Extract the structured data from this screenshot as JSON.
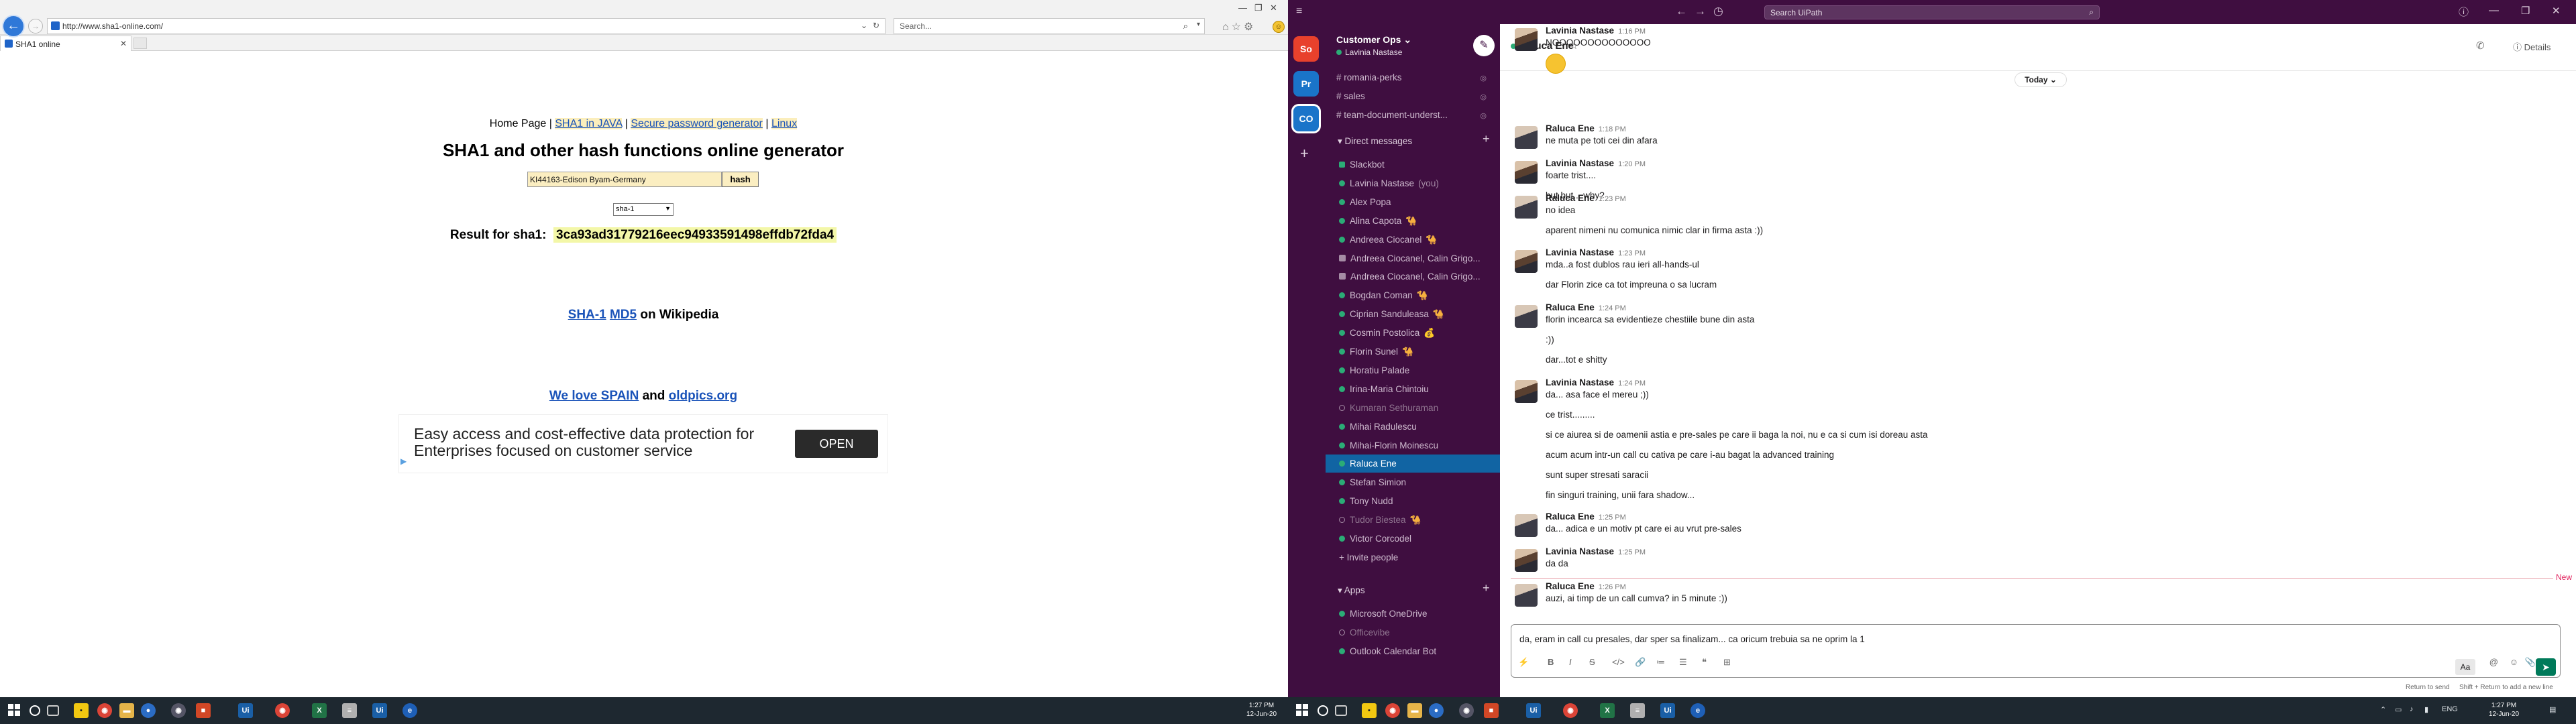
{
  "browser": {
    "address_url": "http://www.sha1-online.com/",
    "search_placeholder": "Search...",
    "tab_title": "SHA1 online"
  },
  "webpage": {
    "nav": {
      "home": "Home Page",
      "sep": "|",
      "java": "SHA1 in JAVA",
      "pwgen": "Secure password generator",
      "linux": "Linux"
    },
    "title": "SHA1 and other hash functions online generator",
    "input_value": "KI44163-Edison Byam-Germany",
    "hash_button": "hash",
    "algorithm_selected": "sha-1",
    "result_label": "Result for sha1:",
    "result_hash": "3ca93ad31779216eec94933591498effdb72fda4",
    "wiki": {
      "sha1": "SHA-1",
      "md5": "MD5",
      "suffix": "on Wikipedia"
    },
    "spain": {
      "link1": "We love SPAIN",
      "and": "and",
      "link2": "oldpics.org"
    },
    "ad": {
      "text": "Easy access and cost-effective data protection for Enterprises focused on customer service",
      "button": "OPEN"
    }
  },
  "taskbar_left": {
    "time": "1:27 PM",
    "date": "12-Jun-20"
  },
  "taskbar_right": {
    "time": "1:27 PM",
    "date": "12-Jun-20",
    "lang": "ENG"
  },
  "slack": {
    "search_placeholder": "Search UiPath",
    "workspaces": [
      {
        "label": "So",
        "color": "#e8412c"
      },
      {
        "label": "Pr",
        "color": "#1a74c9"
      },
      {
        "label": "CO",
        "color": "#1a74c9"
      }
    ],
    "team_name": "Customer Ops",
    "team_caret": "⌄",
    "current_user": "Lavinia Nastase",
    "channels": [
      "# romania-perks",
      "# sales",
      "# team-document-underst..."
    ],
    "dm_header": "Direct messages",
    "dms": [
      {
        "name": "Slackbot",
        "status": "bot",
        "extra": ""
      },
      {
        "name": "Lavinia Nastase",
        "status": "on",
        "extra": "(you)"
      },
      {
        "name": "Alex Popa",
        "status": "on",
        "extra": ""
      },
      {
        "name": "Alina Capota",
        "status": "on",
        "extra": "🐪"
      },
      {
        "name": "Andreea Ciocanel",
        "status": "on",
        "extra": "🐪"
      },
      {
        "name": "Andreea Ciocanel, Calin Grigo...",
        "status": "group",
        "extra": ""
      },
      {
        "name": "Andreea Ciocanel, Calin Grigo...",
        "status": "group",
        "extra": ""
      },
      {
        "name": "Bogdan Coman",
        "status": "on",
        "extra": "🐪"
      },
      {
        "name": "Ciprian Sanduleasa",
        "status": "on",
        "extra": "🐪"
      },
      {
        "name": "Cosmin Postolica",
        "status": "on",
        "extra": "💰"
      },
      {
        "name": "Florin Sunel",
        "status": "on",
        "extra": "🐪"
      },
      {
        "name": "Horatiu Palade",
        "status": "on",
        "extra": ""
      },
      {
        "name": "Irina-Maria Chintoiu",
        "status": "on",
        "extra": ""
      },
      {
        "name": "Kumaran Sethuraman",
        "status": "off",
        "extra": ""
      },
      {
        "name": "Mihai Radulescu",
        "status": "on",
        "extra": ""
      },
      {
        "name": "Mihai-Florin Moinescu",
        "status": "on",
        "extra": ""
      },
      {
        "name": "Raluca Ene",
        "status": "on",
        "extra": "",
        "active": true
      },
      {
        "name": "Stefan Simion",
        "status": "on",
        "extra": ""
      },
      {
        "name": "Tony Nudd",
        "status": "on",
        "extra": ""
      },
      {
        "name": "Tudor Biestea",
        "status": "off",
        "extra": "🐪"
      },
      {
        "name": "Victor Corcodel",
        "status": "on",
        "extra": ""
      },
      {
        "name": "Invite people",
        "status": "plus",
        "extra": ""
      }
    ],
    "apps_header": "Apps",
    "apps": [
      {
        "name": "Microsoft OneDrive",
        "status": "on"
      },
      {
        "name": "Officevibe",
        "status": "off"
      },
      {
        "name": "Outlook Calendar Bot",
        "status": "on"
      }
    ],
    "channel_title": "Raluca Ene",
    "details": "Details",
    "date_pill": "Today ⌄",
    "messages": [
      {
        "author": "Lavinia Nastase",
        "time": "1:16 PM",
        "lines": [
          "NOOOOOOOOOOOOOO"
        ],
        "avatar": "l"
      },
      {
        "author": "Raluca Ene",
        "time": "1:18 PM",
        "lines": [
          "ne muta pe toti cei din afara"
        ],
        "avatar": "r"
      },
      {
        "author": "Lavinia Nastase",
        "time": "1:20 PM",
        "lines": [
          "foarte trist....",
          "but but....why?"
        ],
        "avatar": "l"
      },
      {
        "author": "Raluca Ene",
        "time": "1:23 PM",
        "lines": [
          "no idea",
          "aparent nimeni nu comunica nimic clar in firma asta :))"
        ],
        "avatar": "r"
      },
      {
        "author": "Lavinia Nastase",
        "time": "1:23 PM",
        "lines": [
          "mda..a fost dublos rau ieri all-hands-ul",
          "dar Florin zice ca tot impreuna o sa lucram"
        ],
        "avatar": "l"
      },
      {
        "author": "Raluca Ene",
        "time": "1:24 PM",
        "lines": [
          "florin incearca sa evidentieze chestiile bune din asta",
          ":))",
          "dar...tot e shitty"
        ],
        "avatar": "r"
      },
      {
        "author": "Lavinia Nastase",
        "time": "1:24 PM",
        "lines": [
          "da... asa face el mereu ;))",
          "ce trist.........",
          "si ce aiurea si de oamenii astia e pre-sales pe care ii baga la noi, nu e ca si cum isi doreau asta",
          "acum acum intr-un call cu cativa pe care i-au bagat la advanced training",
          "sunt super stresati saracii",
          "fin singuri training, unii fara shadow..."
        ],
        "avatar": "l"
      },
      {
        "author": "Raluca Ene",
        "time": "1:25 PM",
        "lines": [
          "da... adica e un motiv pt care ei au vrut pre-sales"
        ],
        "avatar": "r"
      },
      {
        "author": "Lavinia Nastase",
        "time": "1:25 PM",
        "lines": [
          "da da"
        ],
        "avatar": "l"
      },
      {
        "author": "Raluca Ene",
        "time": "1:26 PM",
        "lines": [
          "auzi, ai timp de un call cumva? in 5 minute :))"
        ],
        "avatar": "r"
      }
    ],
    "new_label": "New",
    "composer_text": "da, eram in call cu presales, dar sper sa finalizam... ca oricum trebuia sa ne oprim la 1",
    "hint_send": "Return to send",
    "hint_newline": "Shift + Return to add a new line"
  }
}
